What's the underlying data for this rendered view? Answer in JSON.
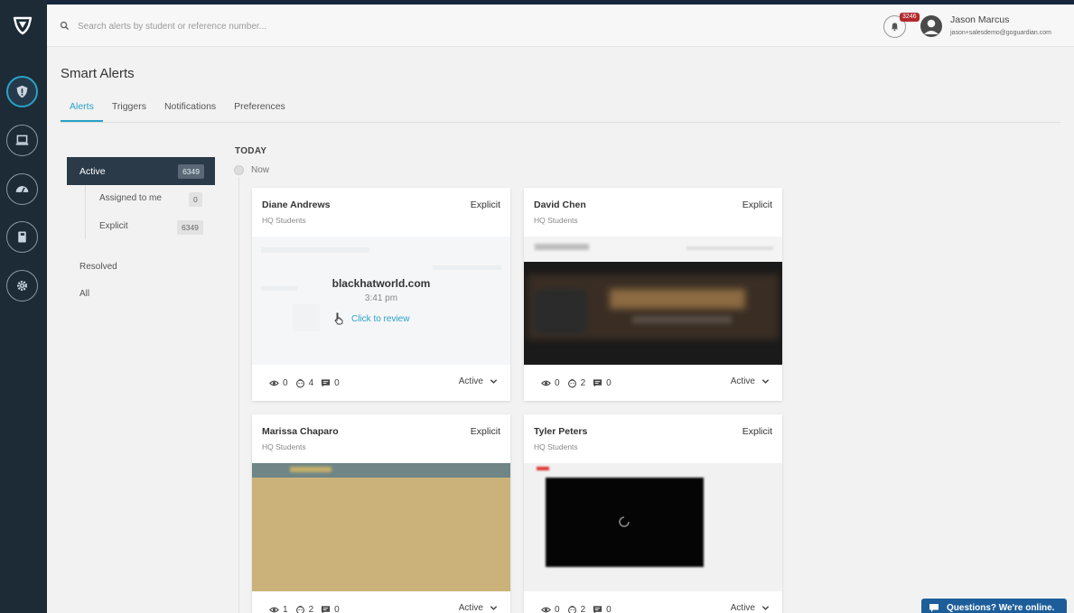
{
  "search": {
    "placeholder": "Search alerts by student or reference number..."
  },
  "user": {
    "name": "Jason Marcus",
    "email": "jason+salesdemo@goguardian.com",
    "notifications": "3246"
  },
  "page": {
    "title": "Smart Alerts"
  },
  "tabs": [
    {
      "label": "Alerts",
      "active": true
    },
    {
      "label": "Triggers"
    },
    {
      "label": "Notifications"
    },
    {
      "label": "Preferences"
    }
  ],
  "filters": {
    "active": {
      "label": "Active",
      "count": "6349"
    },
    "assigned": {
      "label": "Assigned to me",
      "count": "0"
    },
    "explicit": {
      "label": "Explicit",
      "count": "6349"
    },
    "resolved": "Resolved",
    "all": "All"
  },
  "timeline": {
    "heading": "TODAY",
    "now": "Now"
  },
  "cards": [
    {
      "name": "Diane Andrews",
      "group": "HQ Students",
      "tag": "Explicit",
      "domain": "blackhatworld.com",
      "time": "3:41 pm",
      "review": "Click to review",
      "views": "0",
      "flags": "4",
      "comments": "0",
      "status": "Active"
    },
    {
      "name": "David Chen",
      "group": "HQ Students",
      "tag": "Explicit",
      "views": "0",
      "flags": "2",
      "comments": "0",
      "status": "Active"
    },
    {
      "name": "Marissa Chaparo",
      "group": "HQ Students",
      "tag": "Explicit",
      "views": "1",
      "flags": "2",
      "comments": "0",
      "status": "Active"
    },
    {
      "name": "Tyler Peters",
      "group": "HQ Students",
      "tag": "Explicit",
      "views": "0",
      "flags": "2",
      "comments": "0",
      "status": "Active"
    }
  ],
  "chat": {
    "label": "Questions? We're online."
  },
  "colors": {
    "accent": "#2aa2c8",
    "sidebar": "#1c2b36",
    "badge": "#b2282c",
    "chat": "#1d5e9a"
  }
}
